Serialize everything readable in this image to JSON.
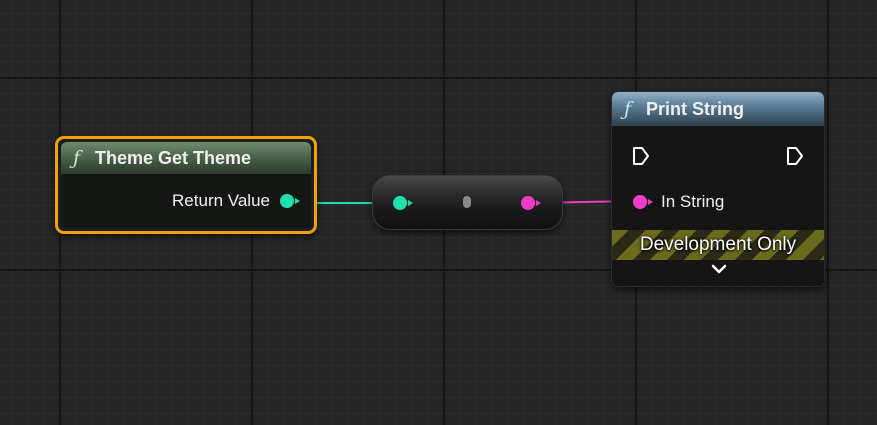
{
  "nodes": {
    "theme_get_theme": {
      "title": "Theme Get Theme",
      "icon": "function-icon",
      "output_pin": "Return Value",
      "selected": true,
      "highlight_color": "#f2a00c",
      "header_color": "#5a765a"
    },
    "conversion": {
      "input_pin_color": "#1fe0ac",
      "output_pin_color": "#f03ac8"
    },
    "print_string": {
      "title": "Print String",
      "icon": "function-icon",
      "input_pin": "In String",
      "banner": "Development Only",
      "header_color": "#6d8ea4"
    }
  },
  "icon_glyphs": {
    "function": "ƒ"
  }
}
